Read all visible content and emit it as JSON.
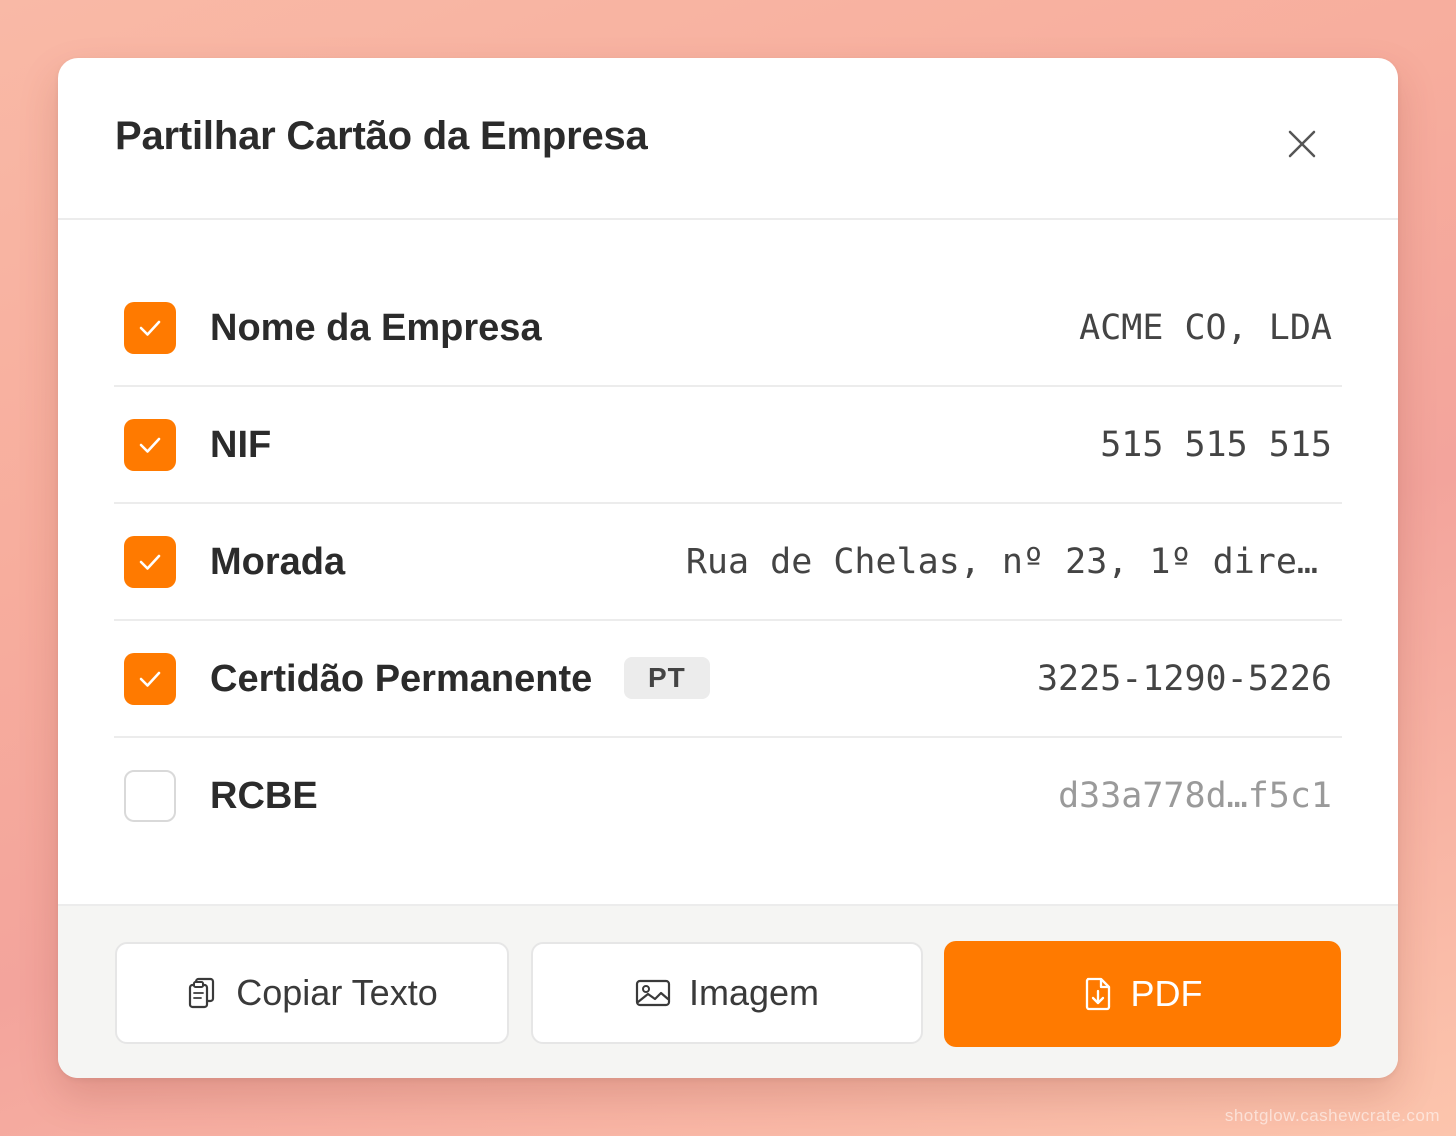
{
  "dialog": {
    "title": "Partilhar Cartão da Empresa",
    "close_icon": "close-icon"
  },
  "fields": [
    {
      "label": "Nome da Empresa",
      "value": "ACME CO, LDA",
      "checked": true
    },
    {
      "label": "NIF",
      "value": "515 515 515",
      "checked": true
    },
    {
      "label": "Morada",
      "value": "Rua de Chelas, nº 23, 1º dire…",
      "checked": true
    },
    {
      "label": "Certidão Permanente",
      "badge": "PT",
      "value": "3225-1290-5226",
      "checked": true
    },
    {
      "label": "RCBE",
      "value": "d33a778d…f5c1",
      "checked": false
    }
  ],
  "actions": {
    "copy_text": {
      "label": "Copiar Texto",
      "icon": "clipboard-icon"
    },
    "image": {
      "label": "Imagem",
      "icon": "image-icon"
    },
    "pdf": {
      "label": "PDF",
      "icon": "file-download-icon"
    }
  },
  "colors": {
    "accent": "#ff7a00",
    "text": "#2b2b2b",
    "muted": "#9a9a9a"
  },
  "watermark": "shotglow.cashewcrate.com"
}
